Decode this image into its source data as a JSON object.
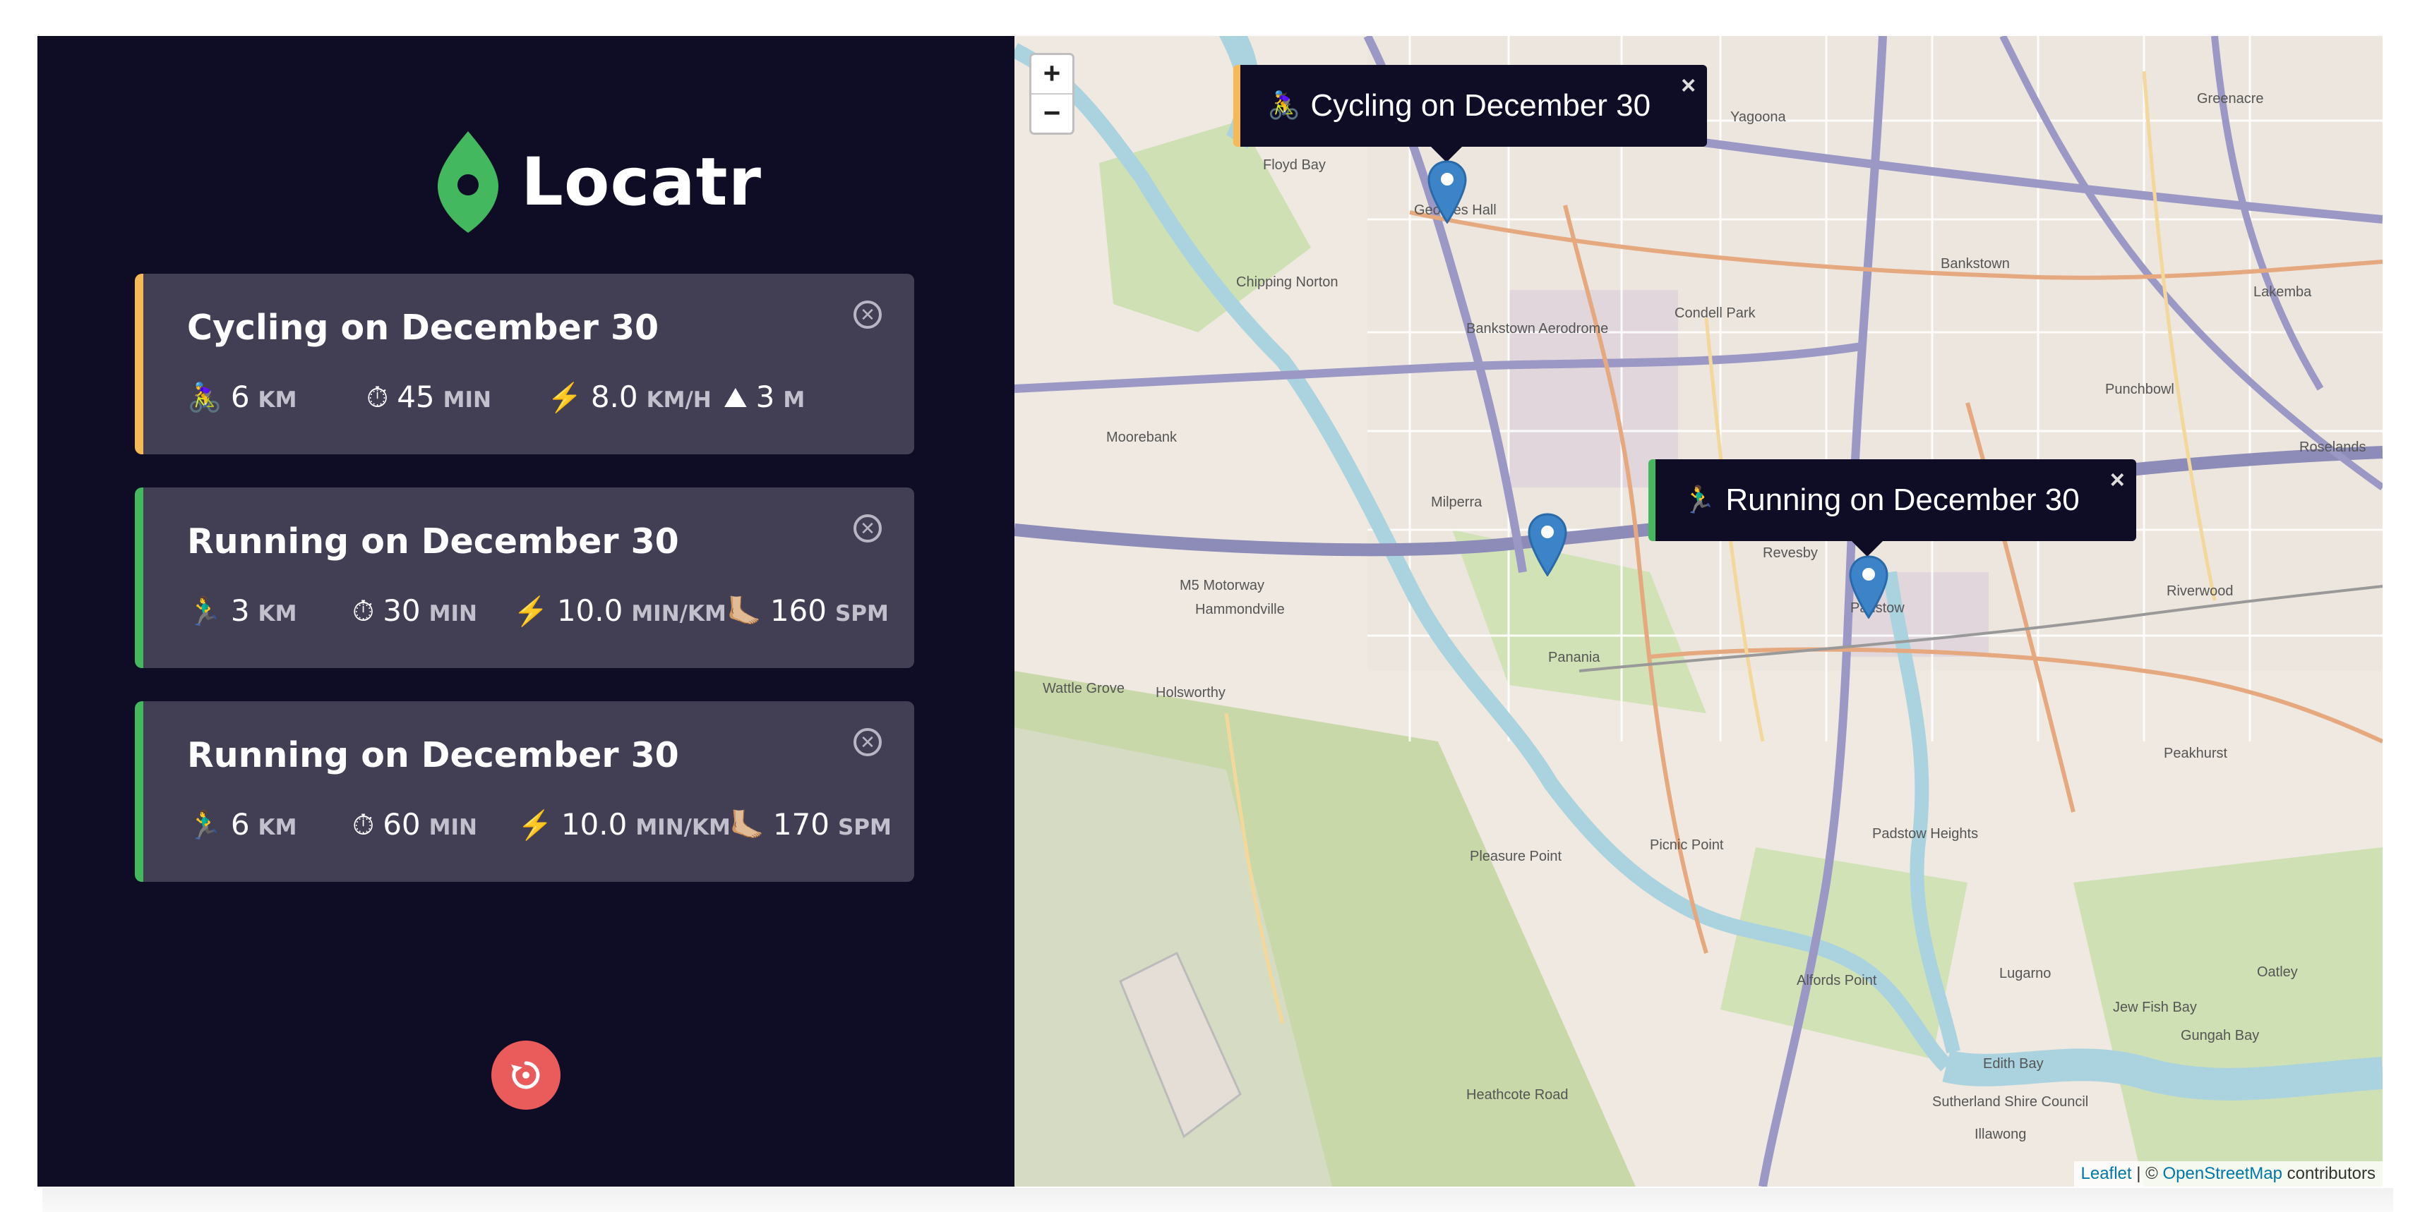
{
  "app": {
    "name": "Locatr"
  },
  "workouts": [
    {
      "title": "Cycling on December 30",
      "type": "cycling",
      "stats": [
        {
          "icon": "🚴‍♀️",
          "value": "6",
          "unit": "KM"
        },
        {
          "icon": "⏱",
          "value": "45",
          "unit": "MIN"
        },
        {
          "icon": "⚡️",
          "value": "8.0",
          "unit": "KM/H"
        },
        {
          "icon": "⛰",
          "value": "3",
          "unit": "M"
        }
      ]
    },
    {
      "title": "Running on December 30",
      "type": "running",
      "stats": [
        {
          "icon": "🏃‍♂️",
          "value": "3",
          "unit": "KM"
        },
        {
          "icon": "⏱",
          "value": "30",
          "unit": "MIN"
        },
        {
          "icon": "⚡️",
          "value": "10.0",
          "unit": "MIN/KM"
        },
        {
          "icon": "🦶🏼",
          "value": "160",
          "unit": "SPM"
        }
      ]
    },
    {
      "title": "Running on December 30",
      "type": "running",
      "stats": [
        {
          "icon": "🏃‍♂️",
          "value": "6",
          "unit": "KM"
        },
        {
          "icon": "⏱",
          "value": "60",
          "unit": "MIN"
        },
        {
          "icon": "⚡️",
          "value": "10.0",
          "unit": "MIN/KM"
        },
        {
          "icon": "🦶🏼",
          "value": "170",
          "unit": "SPM"
        }
      ]
    }
  ],
  "map": {
    "zoom_in": "+",
    "zoom_out": "−",
    "popups": [
      {
        "emoji": "🚴‍♀️",
        "text": "Cycling on December 30",
        "close": "×"
      },
      {
        "emoji": "🏃‍♂️",
        "text": "Running on December 30",
        "close": "×"
      }
    ],
    "attribution": {
      "leaflet": "Leaflet",
      "separator": " | © ",
      "osm": "OpenStreetMap",
      "suffix": " contributors"
    },
    "labels": [
      "Floyd Bay",
      "Yagoona",
      "Greenacre",
      "Bankstown",
      "Lakemba",
      "Chipping Norton",
      "Condell Park",
      "Bankstown Aerodrome",
      "Punchbowl",
      "Roselands",
      "Moorebank",
      "Milperra",
      "M5 Motorway",
      "Hammondville",
      "Revesby",
      "Panania",
      "Padstow",
      "Riverwood",
      "Wattle Grove",
      "Holsworthy",
      "Picnic Point",
      "Pleasure Point",
      "Padstow Heights",
      "Peakhurst",
      "Lugarno",
      "Alfords Point",
      "Jew Fish Bay",
      "Gungah Bay",
      "Oatley",
      "Edith Bay",
      "Sutherland Shire Council",
      "Illawong",
      "Heathcote Road",
      "Georges Hall"
    ]
  },
  "colors": {
    "sidebar_bg": "#0f0c26",
    "card_bg": "#423f55",
    "cycling_accent": "#f6b954",
    "running_accent": "#43b85f",
    "logo_green": "#43b85f",
    "reset_red": "#ea5b5b",
    "marker_blue": "#3d83c7"
  }
}
